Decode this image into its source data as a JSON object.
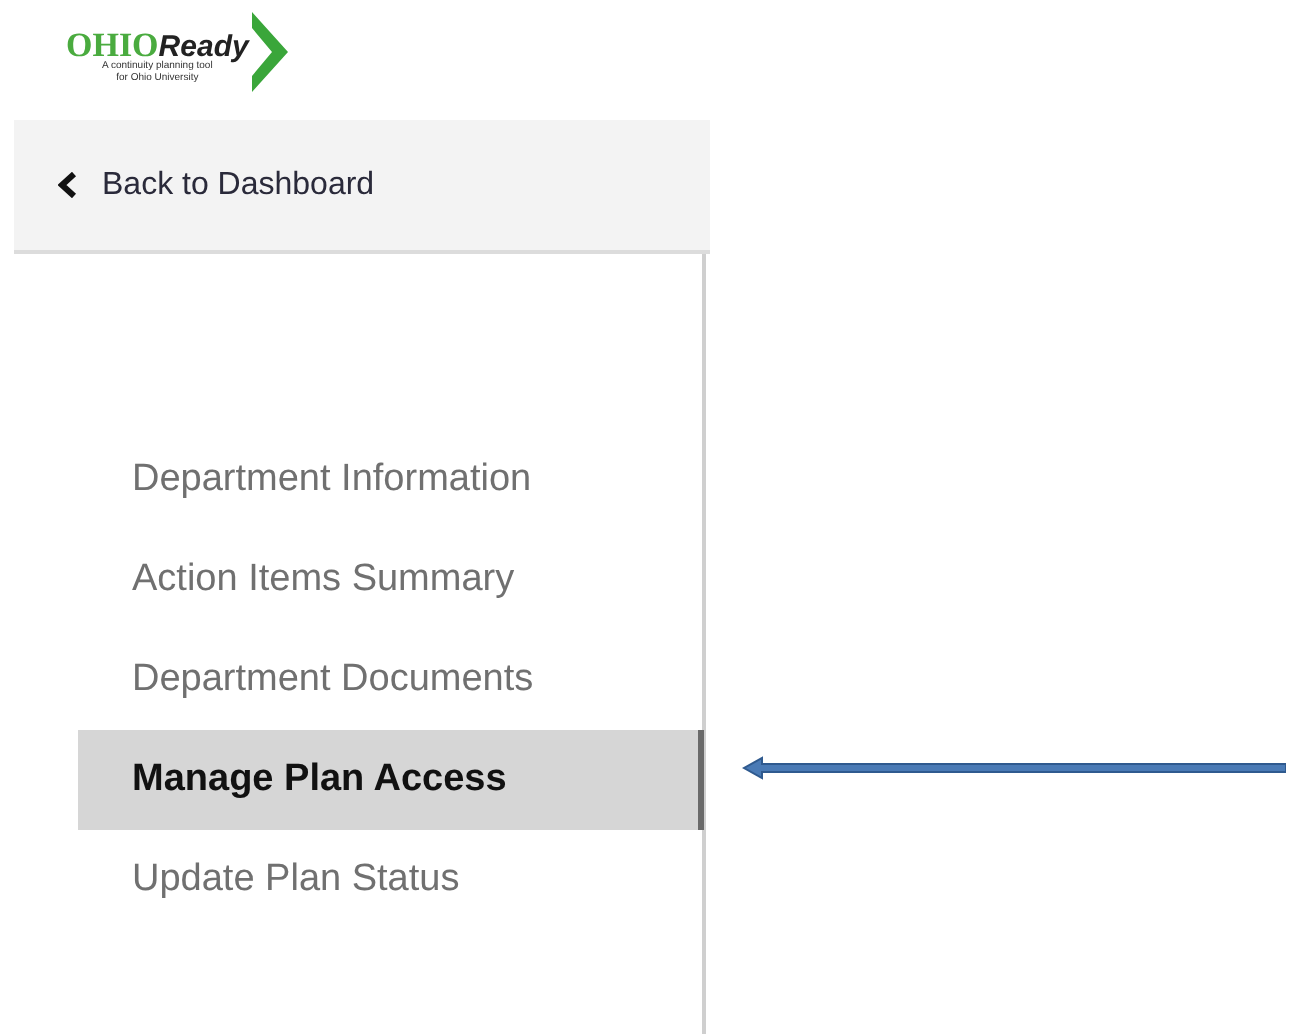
{
  "logo": {
    "word_1": "OHIO",
    "word_2": "Ready",
    "tagline_1": "A continuity planning tool",
    "tagline_2": "for Ohio University"
  },
  "back_link": {
    "label": "Back to Dashboard"
  },
  "sidebar": {
    "items": [
      {
        "label": "Department Information",
        "selected": false
      },
      {
        "label": "Action Items Summary",
        "selected": false
      },
      {
        "label": "Department Documents",
        "selected": false
      },
      {
        "label": "Manage Plan Access",
        "selected": true
      },
      {
        "label": "Update Plan Status",
        "selected": false
      }
    ]
  },
  "annotation": {
    "kind": "arrow"
  }
}
